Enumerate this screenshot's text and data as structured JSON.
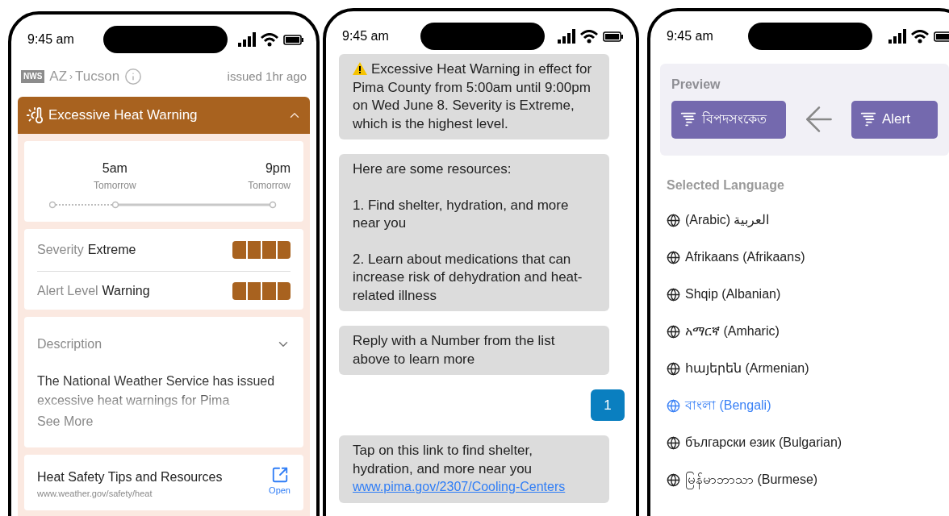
{
  "alert_screen": {
    "status_bar": {
      "time": "9:45 am"
    },
    "header": {
      "logo_text": "NWS",
      "state": "AZ",
      "separator": "›",
      "city": "Tucson",
      "issued": "issued 1hr ago"
    },
    "alert": {
      "title": "Excessive Heat Warning",
      "expanded": true
    },
    "timeline": {
      "start": {
        "time": "5am",
        "day": "Tomorrow"
      },
      "end": {
        "time": "9pm",
        "day": "Tomorrow"
      }
    },
    "levels": [
      {
        "label": "Severity",
        "value": "Extreme",
        "level": 1
      },
      {
        "label": "Alert Level",
        "value": "Warning",
        "level": 1
      }
    ],
    "description": {
      "title": "Description",
      "expanded": false,
      "text": "The National Weather Service has issued excessive heat warnings for Pima",
      "more": "See More"
    },
    "resource": {
      "title": "Heat Safety Tips and Resources",
      "url": "www.weather.gov/safety/heat",
      "action": "Open"
    }
  },
  "chat_screen": {
    "status_bar": {
      "time": "9:45 am"
    },
    "messages": [
      {
        "kind": "warning",
        "paragraphs": [
          "Excessive Heat Warning in effect for Pima County from 5:00am until 9:00pm on Wed June 8. Severity is Extreme, which is the highest level."
        ]
      },
      {
        "kind": "incoming",
        "paragraphs": [
          "Here are some resources:",
          "1. Find shelter, hydration, and more near you",
          "2. Learn about medications that can increase risk of dehydration and heat-related illness"
        ]
      },
      {
        "kind": "incoming",
        "paragraphs": [
          "Reply with a Number from the list above to learn more"
        ]
      },
      {
        "kind": "outgoing",
        "paragraphs": [
          "1"
        ]
      },
      {
        "kind": "link",
        "paragraphs": [
          "Tap on this link to find shelter, hydration, and more near you"
        ],
        "link": "www.pima.gov/2307/Cooling-Centers"
      }
    ]
  },
  "language_screen": {
    "status_bar": {
      "time": "9:45 am"
    },
    "preview": {
      "title": "Preview",
      "translated": "বিপদসংকেত",
      "original": "Alert"
    },
    "section_title": "Selected Language",
    "languages": [
      {
        "label": "(Arabic) العربية",
        "selected": false
      },
      {
        "label": "Afrikaans (Afrikaans)",
        "selected": false
      },
      {
        "label": "Shqip (Albanian)",
        "selected": false
      },
      {
        "label": "አማርኛ (Amharic)",
        "selected": false
      },
      {
        "label": "հայերեն (Armenian)",
        "selected": false
      },
      {
        "label": "বাংলা (Bengali)",
        "selected": true
      },
      {
        "label": "български език (Bulgarian)",
        "selected": false
      },
      {
        "label": "မြန်မာဘာသာ (Burmese)",
        "selected": false
      }
    ]
  }
}
